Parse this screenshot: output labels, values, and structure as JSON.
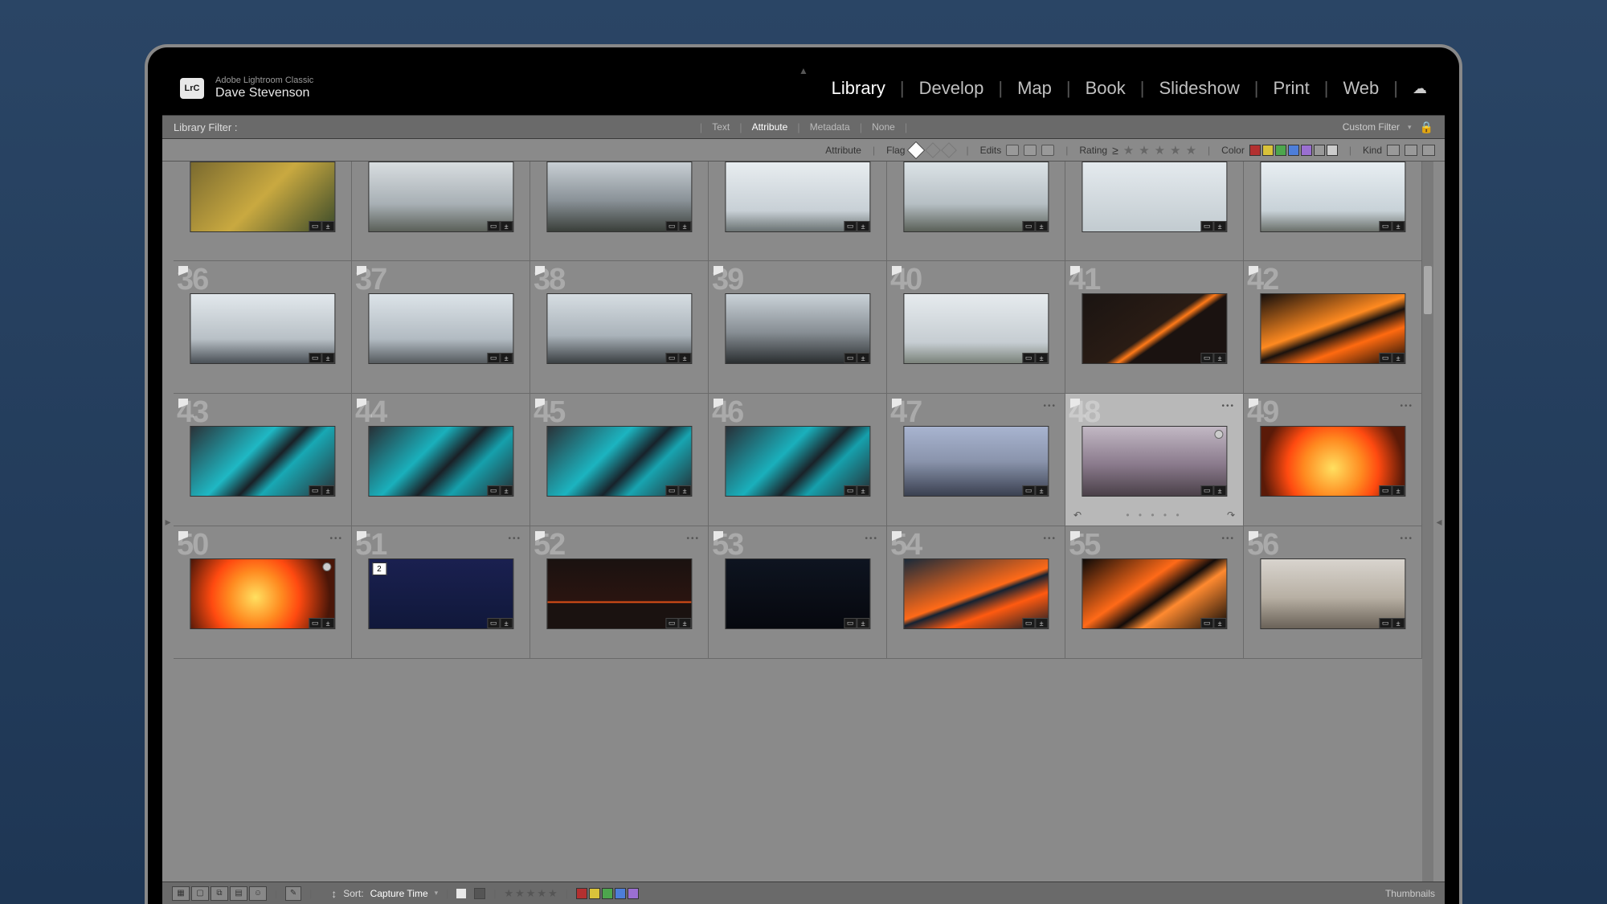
{
  "app": {
    "logo_text": "LrC",
    "name": "Adobe Lightroom Classic",
    "user": "Dave Stevenson"
  },
  "nav": {
    "items": [
      "Library",
      "Develop",
      "Map",
      "Book",
      "Slideshow",
      "Print",
      "Web"
    ],
    "active": "Library"
  },
  "filter_bar": {
    "label": "Library Filter :",
    "tabs": [
      "Text",
      "Attribute",
      "Metadata",
      "None"
    ],
    "active_tab": "Attribute",
    "custom_label": "Custom Filter"
  },
  "attr_bar": {
    "attribute_label": "Attribute",
    "flag_label": "Flag",
    "edits_label": "Edits",
    "rating_label": "Rating",
    "color_label": "Color",
    "kind_label": "Kind",
    "color_swatches": [
      "#b33030",
      "#d9c23a",
      "#4da64d",
      "#4d7ed9",
      "#9a6fd1",
      "#999999",
      "#cccccc"
    ]
  },
  "grid": {
    "rows": [
      {
        "first_row": true,
        "cells": [
          {
            "num": "",
            "bg": "linear-gradient(135deg,#7a6a2f,#c9a940,#3a4a2a)",
            "flag": false
          },
          {
            "num": "",
            "bg": "linear-gradient(180deg,#d8dde0,#a8b0b5 60%,#5a5f58)",
            "flag": false
          },
          {
            "num": "",
            "bg": "linear-gradient(180deg,#c8cfd4,#8a9298 55%,#3a3f3a)",
            "flag": false
          },
          {
            "num": "",
            "bg": "linear-gradient(180deg,#e8edf0,#c8d0d6 70%,#6a7272)",
            "flag": false
          },
          {
            "num": "",
            "bg": "linear-gradient(180deg,#dbe2e6,#b6bfc4 60%,#5a6058)",
            "flag": false
          },
          {
            "num": "",
            "bg": "linear-gradient(180deg,#e4eaee,#c2cbd0)",
            "flag": false
          },
          {
            "num": "",
            "bg": "linear-gradient(180deg,#e8eef2,#c8d2d8 70%,#6a6f6a)",
            "flag": false
          }
        ]
      },
      {
        "cells": [
          {
            "num": "36",
            "bg": "linear-gradient(180deg,#e2e8ec,#b8c0c6 65%,#4a5056)",
            "flag": true
          },
          {
            "num": "37",
            "bg": "linear-gradient(180deg,#dce3e8,#b2bbc2 65%,#555a5e)",
            "flag": true
          },
          {
            "num": "38",
            "bg": "linear-gradient(180deg,#d6dde2,#aab3ba 60%,#3a3f42)",
            "flag": true
          },
          {
            "num": "39",
            "bg": "linear-gradient(180deg,#cad2d8,#888f95 55%,#2a2e30)",
            "flag": true
          },
          {
            "num": "40",
            "bg": "linear-gradient(180deg,#e6ebee,#c6cdd2 70%,#7a827a)",
            "flag": true
          },
          {
            "num": "41",
            "bg": "linear-gradient(145deg,#1a1412,#2a1c14 50%,#ff7a18 55%,#1a1210 60%)",
            "flag": true
          },
          {
            "num": "42",
            "bg": "linear-gradient(160deg,#140e0c,#ff8a20 45%,#1a120e 55%,#ff6a10 70%,#0e0a08)",
            "flag": true
          }
        ]
      },
      {
        "cells": [
          {
            "num": "43",
            "bg": "linear-gradient(135deg,#2a3238,#1fb8c4 40%,#1a2026 55%,#18a8b4 65%,#2a3036)",
            "flag": true
          },
          {
            "num": "44",
            "bg": "linear-gradient(135deg,#283036,#1ab0bc 38%,#1a2026 55%,#16a0ac 70%,#262c32)",
            "flag": true
          },
          {
            "num": "45",
            "bg": "linear-gradient(135deg,#2a3238,#1cb4c0 40%,#18222a 58%,#18a4b0 70%,#242a30)",
            "flag": true
          },
          {
            "num": "46",
            "bg": "linear-gradient(135deg,#283038,#1ab0bc 40%,#1a2228 58%,#16a0ac 70%,#262c32)",
            "flag": true
          },
          {
            "num": "47",
            "bg": "linear-gradient(180deg,#a8b4d0,#8a94ac 50%,#3a4050)",
            "flag": true,
            "dots": true
          },
          {
            "num": "48",
            "bg": "linear-gradient(180deg,#c2b8c4,#8a7a8c 55%,#4a4048)",
            "flag": true,
            "dots": true,
            "selected": true,
            "circle": true
          },
          {
            "num": "49",
            "bg": "radial-gradient(circle at 50% 60%,#ffe060,#ff8a20 35%,#ff4a10 55%,#5a1a08 85%)",
            "flag": true,
            "dots": true
          }
        ]
      },
      {
        "cells": [
          {
            "num": "50",
            "bg": "radial-gradient(circle at 45% 55%,#ffe060,#ff8a20 30%,#ff4a10 50%,#4a1608 85%)",
            "flag": true,
            "dots": true,
            "circle": true
          },
          {
            "num": "51",
            "bg": "linear-gradient(180deg,#1a2050,#10183a)",
            "flag": true,
            "dots": true,
            "stack": "2"
          },
          {
            "num": "52",
            "bg": "linear-gradient(180deg,#1a1210,#2a1410 60%,#ff5a18 62%,#1a1210 64%)",
            "flag": true,
            "dots": true
          },
          {
            "num": "53",
            "bg": "linear-gradient(180deg,#0e1420,#06080e)",
            "flag": true,
            "dots": true
          },
          {
            "num": "54",
            "bg": "linear-gradient(160deg,#1a2a3a,#ff6a18 50%,#142232 55%,#ff5a10 70%,#0e1a28)",
            "flag": true,
            "dots": true
          },
          {
            "num": "55",
            "bg": "linear-gradient(145deg,#0e0a08,#ff6a18 40%,#120c0a 55%,#ff8a30 65%,#0a0806)",
            "flag": true,
            "dots": true
          },
          {
            "num": "56",
            "bg": "linear-gradient(180deg,#d8d4ce,#b8b0a4 55%,#6a6258)",
            "flag": true,
            "dots": true
          }
        ]
      }
    ]
  },
  "bottom": {
    "sort_label": "Sort:",
    "sort_value": "Capture Time",
    "thumbnails_label": "Thumbnails",
    "color_swatches": [
      "#b33030",
      "#d9c23a",
      "#4da64d",
      "#4d7ed9",
      "#9a6fd1"
    ]
  }
}
